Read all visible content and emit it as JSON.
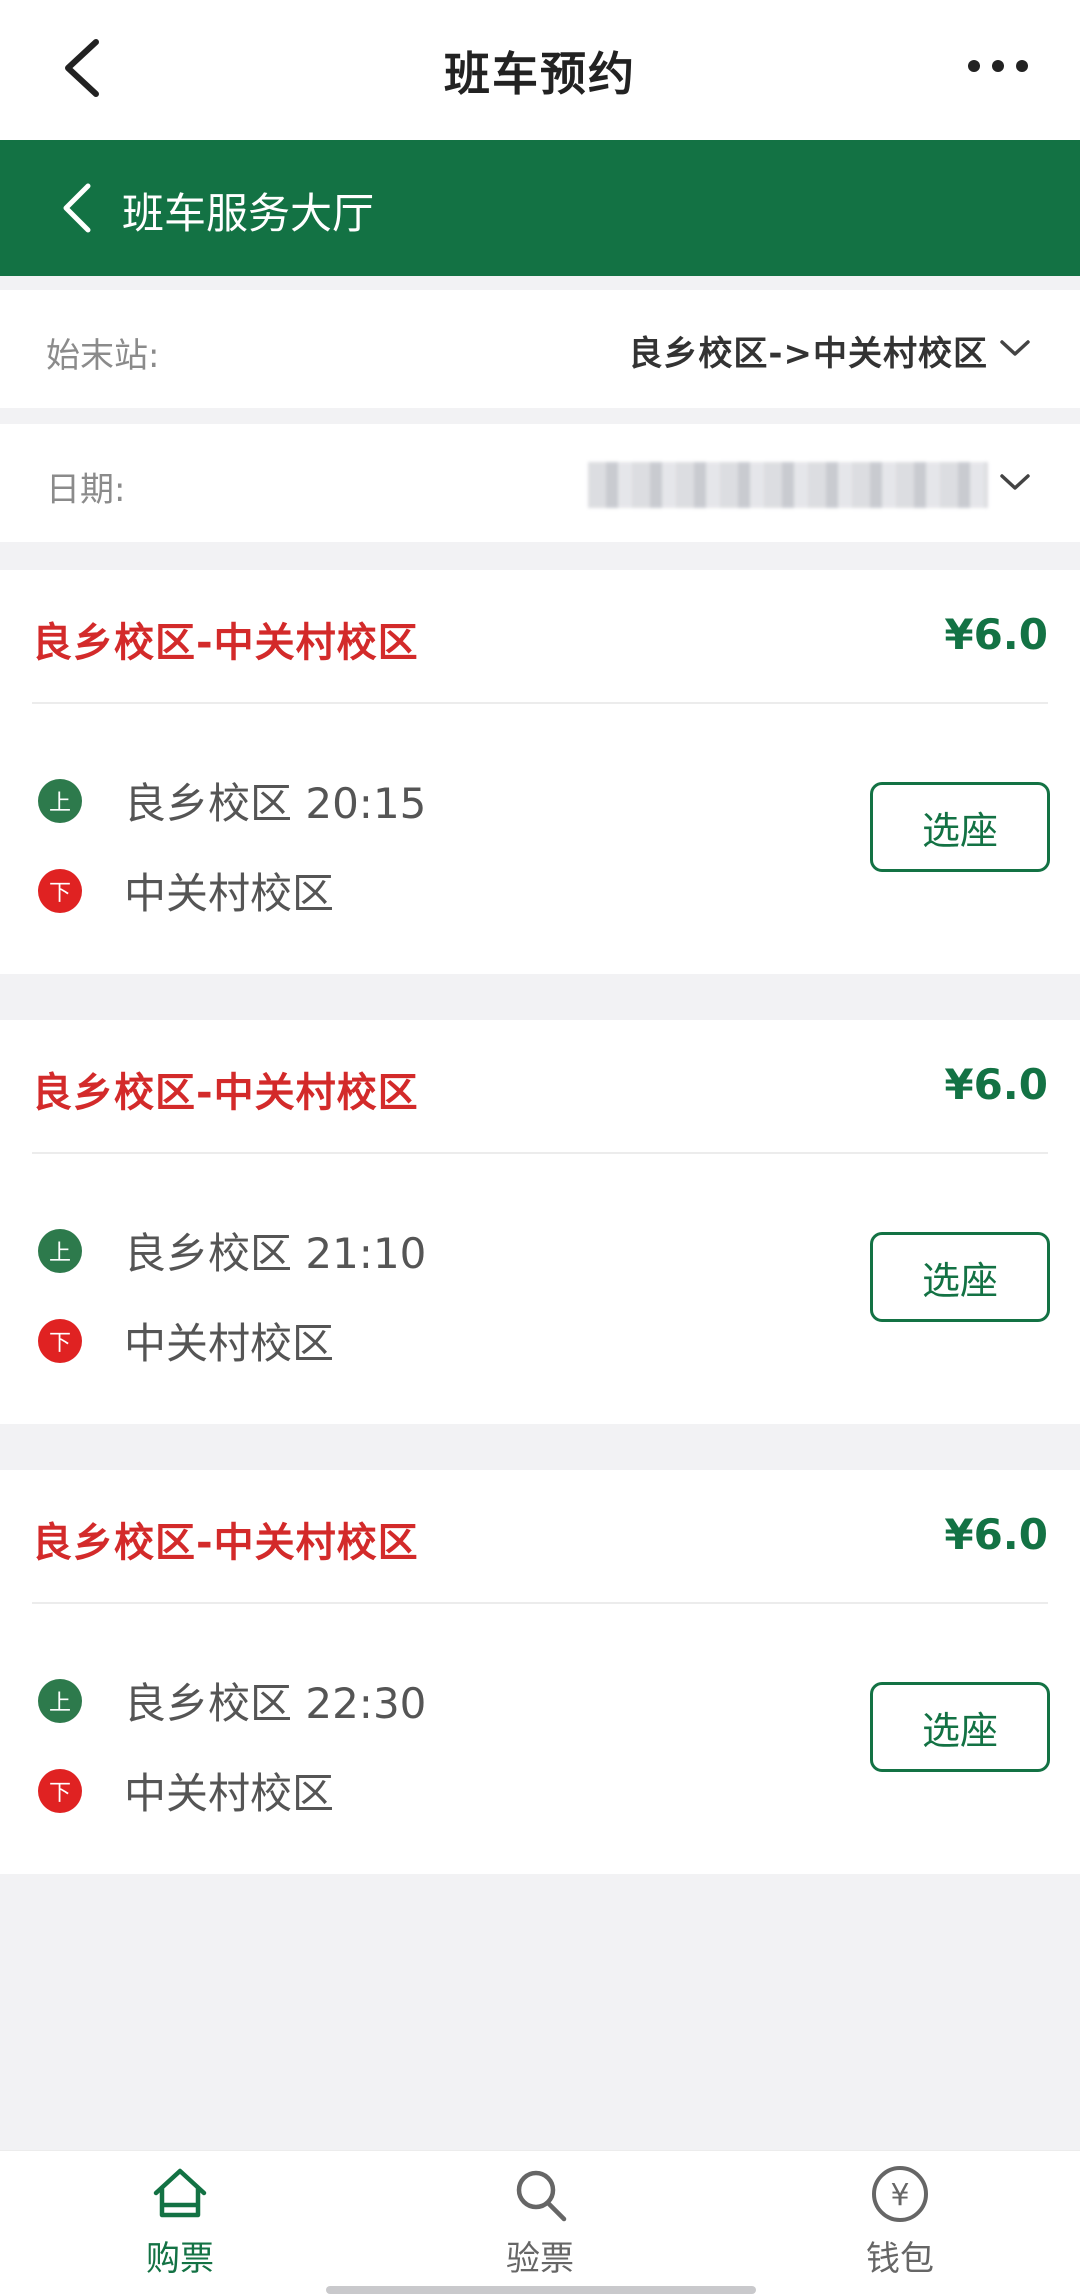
{
  "header": {
    "title": "班车预约",
    "sub_title": "班车服务大厅"
  },
  "filters": {
    "station_label": "始末站:",
    "station_value": "良乡校区->中关村校区",
    "date_label": "日期:"
  },
  "trips": [
    {
      "route": "良乡校区-中关村校区",
      "price": "¥6.0",
      "board_badge": "上",
      "board_stop": "良乡校区 20:15",
      "alight_badge": "下",
      "alight_stop": "中关村校区",
      "button": "选座"
    },
    {
      "route": "良乡校区-中关村校区",
      "price": "¥6.0",
      "board_badge": "上",
      "board_stop": "良乡校区 21:10",
      "alight_badge": "下",
      "alight_stop": "中关村校区",
      "button": "选座"
    },
    {
      "route": "良乡校区-中关村校区",
      "price": "¥6.0",
      "board_badge": "上",
      "board_stop": "良乡校区 22:30",
      "alight_badge": "下",
      "alight_stop": "中关村校区",
      "button": "选座"
    }
  ],
  "tabs": [
    {
      "label": "购票",
      "icon": "home-icon",
      "active": true
    },
    {
      "label": "验票",
      "icon": "search-icon",
      "active": false
    },
    {
      "label": "钱包",
      "icon": "yuan-coin-icon",
      "active": false
    }
  ],
  "colors": {
    "brand_green": "#137244",
    "route_red": "#d32a2a",
    "inactive_tab": "#666666"
  }
}
